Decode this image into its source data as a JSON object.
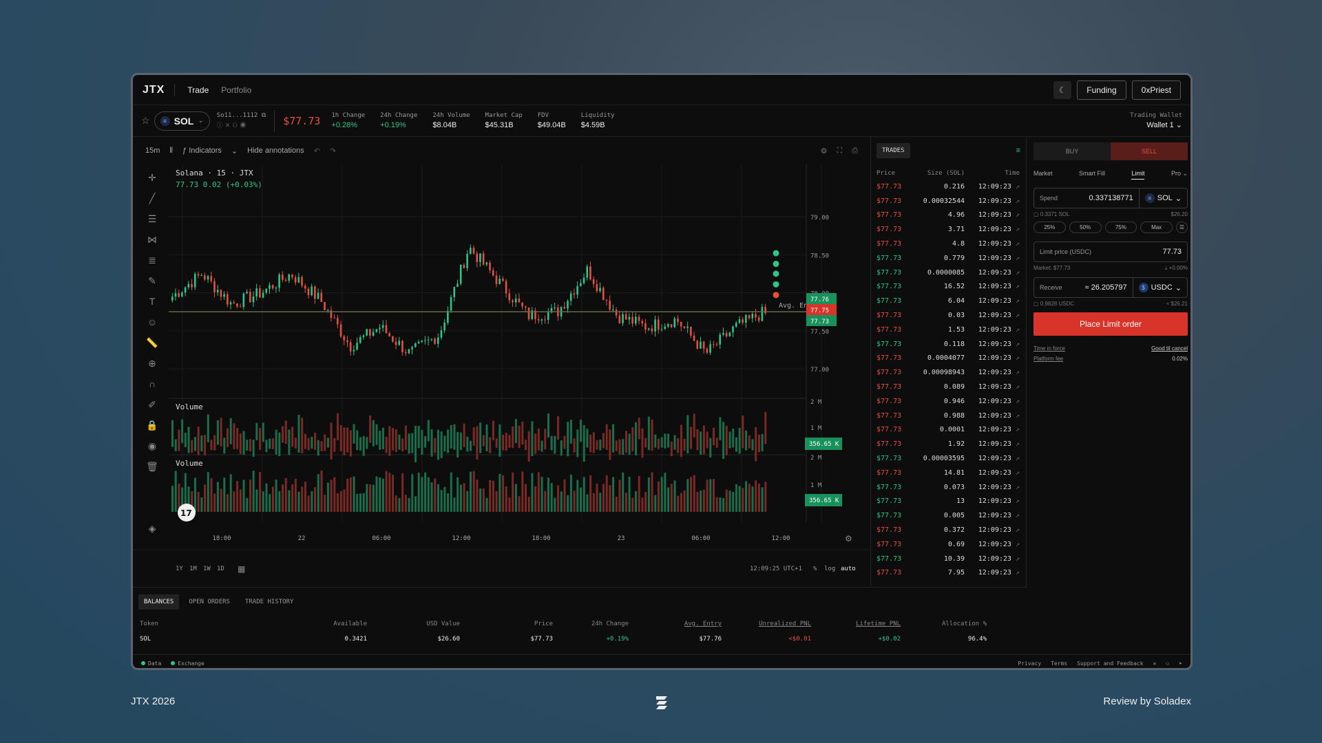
{
  "topbar": {
    "logo": "JTX",
    "nav": [
      "Trade",
      "Portfolio"
    ],
    "theme_icon": "moon-icon",
    "funding": "Funding",
    "account": "0xPriest"
  },
  "market": {
    "pair": "SOL",
    "address": "So11...1112",
    "price": "$77.73",
    "stats": [
      {
        "k": "1h Change",
        "v": "+0.28%",
        "green": true
      },
      {
        "k": "24h Change",
        "v": "+0.19%",
        "green": true
      },
      {
        "k": "24h Volume",
        "v": "$8.04B",
        "green": false
      },
      {
        "k": "Market Cap",
        "v": "$45.31B",
        "green": false
      },
      {
        "k": "FDV",
        "v": "$49.04B",
        "green": false
      },
      {
        "k": "Liquidity",
        "v": "$4.59B",
        "green": false
      }
    ],
    "wallet_label": "Trading Wallet",
    "wallet_value": "Wallet 1"
  },
  "chart": {
    "interval": "15m",
    "indicators": "Indicators",
    "hide_annotations": "Hide annotations",
    "title": "Solana · 15 · JTX",
    "ohlc": "77.73 0.02 (+0.03%)",
    "volume_label": "Volume",
    "y_ticks": [
      "79.00",
      "78.50",
      "78.00",
      "77.50",
      "77.00"
    ],
    "price_tags": [
      {
        "v": "77.76",
        "color": "#18915c"
      },
      {
        "v": "77.75",
        "color": "#d8342a"
      },
      {
        "v": "77.73",
        "color": "#18915c"
      }
    ],
    "avg_entry": "Avg. Entry",
    "vol_ticks": [
      "2 M",
      "1 M"
    ],
    "vol_tag": "356.65 K",
    "x_ticks": [
      "18:00",
      "22",
      "06:00",
      "12:00",
      "18:00",
      "23",
      "06:00",
      "12:00"
    ],
    "ranges": [
      "1Y",
      "1M",
      "1W",
      "1D"
    ],
    "time": "12:09:25 UTC+1",
    "opts": [
      "%",
      "log",
      "auto"
    ],
    "colors": {
      "up": "#2fc48a",
      "down": "#e55040",
      "up_vol": "#1c6e4b",
      "down_vol": "#7a2a24"
    }
  },
  "chart_data": {
    "type": "candlestick",
    "interval": "15m",
    "ylim": [
      76.85,
      79.1
    ],
    "last_price": 77.73,
    "x_ticks": [
      "18:00",
      "22",
      "06:00",
      "12:00",
      "18:00",
      "23",
      "06:00",
      "12:00"
    ],
    "y_ticks": [
      79.0,
      78.5,
      78.0,
      77.5,
      77.0
    ]
  },
  "trades": {
    "tab": "TRADES",
    "cols": [
      "Price",
      "Size (SOL)",
      "Time"
    ],
    "rows": [
      {
        "p": "$77.73",
        "s": "0.216",
        "t": "12:09:23",
        "c": "red"
      },
      {
        "p": "$77.73",
        "s": "0.00032544",
        "t": "12:09:23",
        "c": "red"
      },
      {
        "p": "$77.73",
        "s": "4.96",
        "t": "12:09:23",
        "c": "red"
      },
      {
        "p": "$77.73",
        "s": "3.71",
        "t": "12:09:23",
        "c": "red"
      },
      {
        "p": "$77.73",
        "s": "4.8",
        "t": "12:09:23",
        "c": "red"
      },
      {
        "p": "$77.73",
        "s": "0.779",
        "t": "12:09:23",
        "c": "green"
      },
      {
        "p": "$77.73",
        "s": "0.0000085",
        "t": "12:09:23",
        "c": "green"
      },
      {
        "p": "$77.73",
        "s": "16.52",
        "t": "12:09:23",
        "c": "green"
      },
      {
        "p": "$77.73",
        "s": "6.04",
        "t": "12:09:23",
        "c": "green"
      },
      {
        "p": "$77.73",
        "s": "0.03",
        "t": "12:09:23",
        "c": "red"
      },
      {
        "p": "$77.73",
        "s": "1.53",
        "t": "12:09:23",
        "c": "red"
      },
      {
        "p": "$77.73",
        "s": "0.118",
        "t": "12:09:23",
        "c": "green"
      },
      {
        "p": "$77.73",
        "s": "0.0004077",
        "t": "12:09:23",
        "c": "red"
      },
      {
        "p": "$77.73",
        "s": "0.00098943",
        "t": "12:09:23",
        "c": "red"
      },
      {
        "p": "$77.73",
        "s": "0.089",
        "t": "12:09:23",
        "c": "red"
      },
      {
        "p": "$77.73",
        "s": "0.946",
        "t": "12:09:23",
        "c": "red"
      },
      {
        "p": "$77.73",
        "s": "0.988",
        "t": "12:09:23",
        "c": "red"
      },
      {
        "p": "$77.73",
        "s": "0.0001",
        "t": "12:09:23",
        "c": "red"
      },
      {
        "p": "$77.73",
        "s": "1.92",
        "t": "12:09:23",
        "c": "red"
      },
      {
        "p": "$77.73",
        "s": "0.00003595",
        "t": "12:09:23",
        "c": "green"
      },
      {
        "p": "$77.73",
        "s": "14.81",
        "t": "12:09:23",
        "c": "red"
      },
      {
        "p": "$77.73",
        "s": "0.073",
        "t": "12:09:23",
        "c": "green"
      },
      {
        "p": "$77.73",
        "s": "13",
        "t": "12:09:23",
        "c": "green"
      },
      {
        "p": "$77.73",
        "s": "0.005",
        "t": "12:09:23",
        "c": "green"
      },
      {
        "p": "$77.73",
        "s": "0.372",
        "t": "12:09:23",
        "c": "red"
      },
      {
        "p": "$77.73",
        "s": "0.69",
        "t": "12:09:23",
        "c": "red"
      },
      {
        "p": "$77.73",
        "s": "10.39",
        "t": "12:09:23",
        "c": "green"
      },
      {
        "p": "$77.73",
        "s": "7.95",
        "t": "12:09:23",
        "c": "red"
      }
    ]
  },
  "order": {
    "buy": "BUY",
    "sell": "SELL",
    "tabs": [
      "Market",
      "Smart Fill",
      "Limit",
      "Pro"
    ],
    "spend_label": "Spend",
    "spend_value": "0.337138771",
    "spend_token": "SOL",
    "spend_balance": "0.3371 SOL",
    "spend_usd": "$26.20",
    "pcts": [
      "25%",
      "50%",
      "75%",
      "Max"
    ],
    "limit_label": "Limit price (USDC)",
    "limit_value": "77.73",
    "market_ref": "Market: $77.73",
    "market_diff": "+0.00%",
    "receive_label": "Receive",
    "receive_value": "≈ 26.205797",
    "receive_token": "USDC",
    "receive_balance": "0.9828 USDC",
    "receive_usd": "≈ $26.21",
    "place": "Place Limit order",
    "tif_k": "Time in force",
    "tif_v": "Good til cancel",
    "fee_k": "Platform fee",
    "fee_v": "0.02%"
  },
  "bottom": {
    "tabs": [
      "BALANCES",
      "OPEN ORDERS",
      "TRADE HISTORY"
    ],
    "cols": [
      "Token",
      "Available",
      "USD Value",
      "Price",
      "24h Change",
      "Avg. Entry",
      "Unrealized PNL",
      "Lifetime PNL",
      "Allocation %"
    ],
    "row": [
      "SOL",
      "0.3421",
      "$26.60",
      "$77.73",
      "+0.19%",
      "$77.76",
      "<$0.01",
      "+$0.02",
      "96.4%"
    ]
  },
  "footer": {
    "data": "Data",
    "exchange": "Exchange",
    "links": [
      "Privacy",
      "Terms",
      "Support and Feedback"
    ]
  },
  "outer": {
    "left": "JTX 2026",
    "right": "Review by Soladex"
  }
}
